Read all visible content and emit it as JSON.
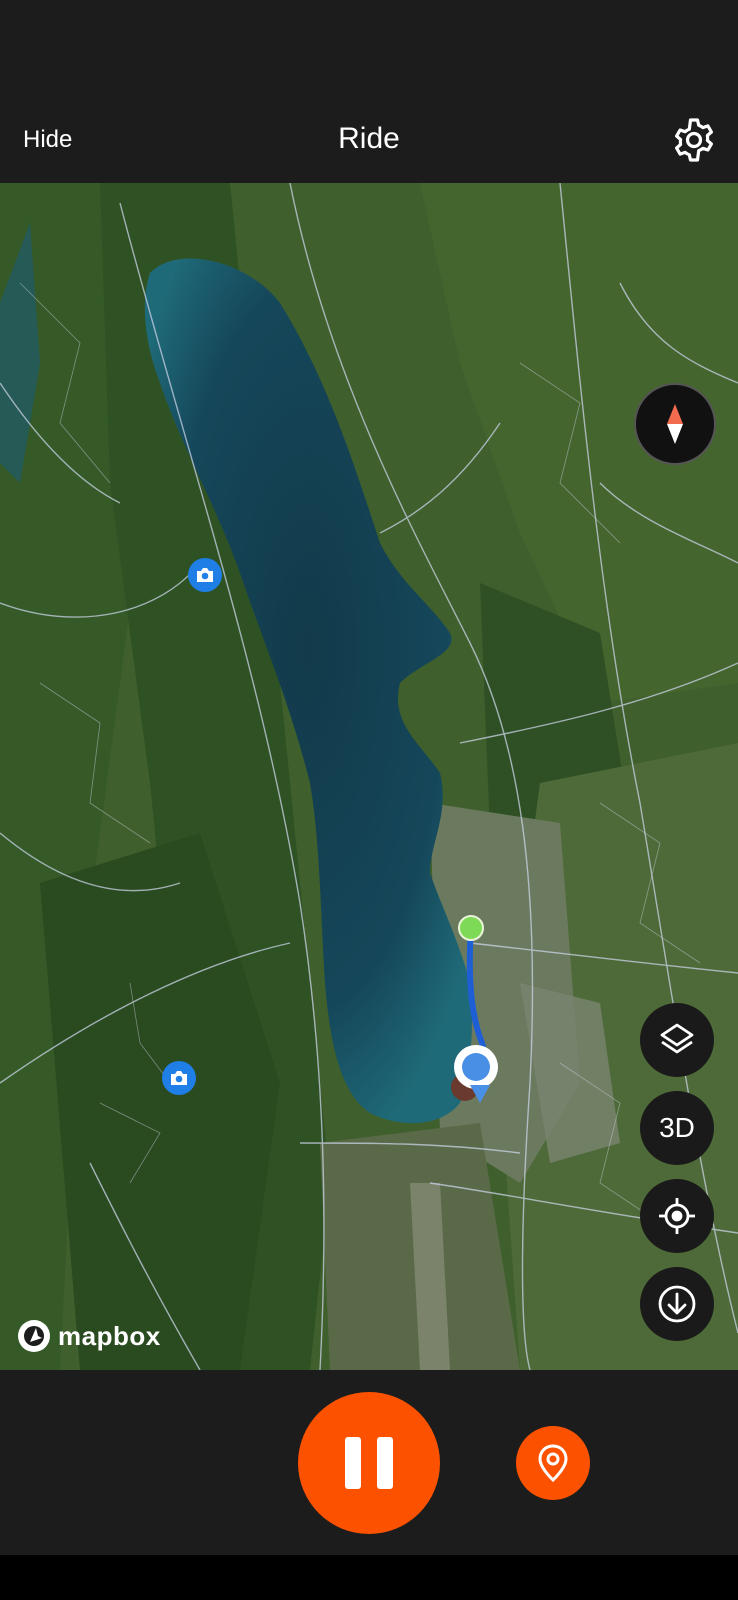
{
  "header": {
    "hide_label": "Hide",
    "title": "Ride",
    "settings_icon": "gear-icon"
  },
  "map": {
    "attribution": "mapbox",
    "controls": {
      "compass_icon": "compass-icon",
      "layers_icon": "layers-icon",
      "three_d_label": "3D",
      "locate_icon": "crosshair-icon",
      "download_icon": "download-icon"
    },
    "markers": [
      "photo-pin",
      "photo-pin",
      "route-start",
      "current-location"
    ]
  },
  "controls": {
    "pause_icon": "pause-icon",
    "pin_icon": "map-pin-icon"
  },
  "colors": {
    "accent": "#fc5200",
    "route": "#1e5fd6",
    "start": "#7ed957",
    "location": "#4a8fe6"
  }
}
